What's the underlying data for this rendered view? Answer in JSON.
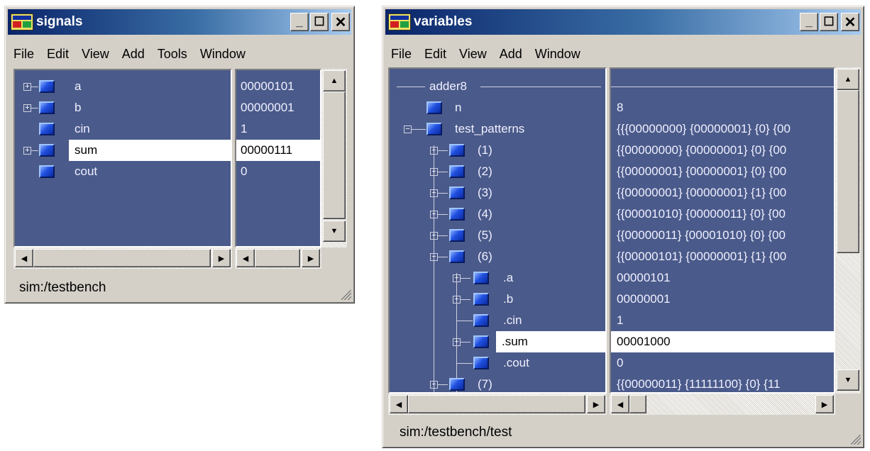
{
  "signals_window": {
    "title": "signals",
    "menu": [
      "File",
      "Edit",
      "View",
      "Add",
      "Tools",
      "Window"
    ],
    "rows": [
      {
        "name": "a",
        "value": "00000101"
      },
      {
        "name": "b",
        "value": "00000001"
      },
      {
        "name": "cin",
        "value": "1"
      },
      {
        "name": "sum",
        "value": "00000111"
      },
      {
        "name": "cout",
        "value": "0"
      }
    ],
    "status": "sim:/testbench"
  },
  "variables_window": {
    "title": "variables",
    "menu": [
      "File",
      "Edit",
      "View",
      "Add",
      "Window"
    ],
    "root": "adder8",
    "rows": [
      {
        "name": "n",
        "value": "8"
      },
      {
        "name": "test_patterns",
        "value": "{{{00000000} {00000001} {0} {00"
      },
      {
        "name": "(1)",
        "value": "{{00000000} {00000001} {0} {00"
      },
      {
        "name": "(2)",
        "value": "{{00000001} {00000001} {0} {00"
      },
      {
        "name": "(3)",
        "value": "{{00000001} {00000001} {1} {00"
      },
      {
        "name": "(4)",
        "value": "{{00001010} {00000011} {0} {00"
      },
      {
        "name": "(5)",
        "value": "{{00000011} {00001010} {0} {00"
      },
      {
        "name": "(6)",
        "value": "{{00000101} {00000001} {1} {00"
      },
      {
        "name": ".a",
        "value": "00000101"
      },
      {
        "name": ".b",
        "value": "00000001"
      },
      {
        "name": ".cin",
        "value": "1"
      },
      {
        "name": ".sum",
        "value": "00001000"
      },
      {
        "name": ".cout",
        "value": "0"
      },
      {
        "name": "(7)",
        "value": "{{00000011} {11111100} {0} {11"
      }
    ],
    "status": "sim:/testbench/test"
  },
  "colors": {
    "pane_bg": "#4a5a8a",
    "title_gradient_start": "#0a246a",
    "title_gradient_end": "#a6caf0",
    "window_face": "#d4d0c8"
  }
}
